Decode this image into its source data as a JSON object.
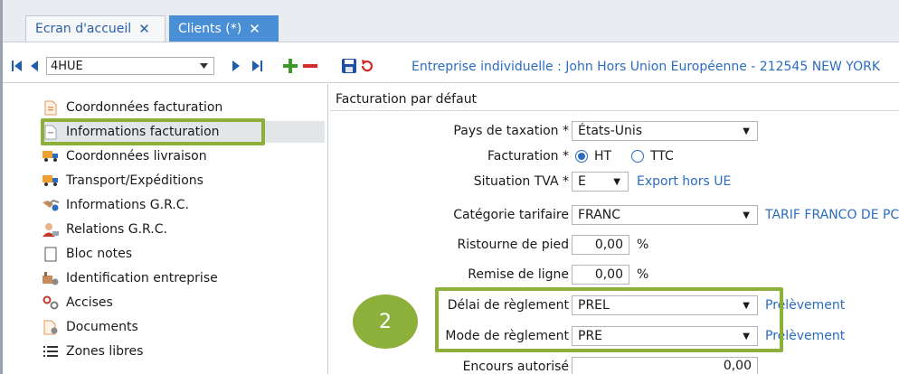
{
  "tabs": [
    {
      "label": "Ecran d'accueil",
      "close": "✕"
    },
    {
      "label": "Clients (*)",
      "close": "✕"
    }
  ],
  "toolbar": {
    "record_value": "4HUE",
    "entreprise_label": "Entreprise individuelle : John Hors Union Européenne - 212545 NEW YORK"
  },
  "sidebar": {
    "items": [
      {
        "label": "Coordonnées facturation",
        "icon": "document-icon"
      },
      {
        "label": "Informations facturation",
        "icon": "document-icon"
      },
      {
        "label": "Coordonnées livraison",
        "icon": "truck-icon"
      },
      {
        "label": "Transport/Expéditions",
        "icon": "truck-icon"
      },
      {
        "label": "Informations G.R.C.",
        "icon": "handshake-icon"
      },
      {
        "label": "Relations G.R.C.",
        "icon": "user-icon"
      },
      {
        "label": "Bloc notes",
        "icon": "note-icon"
      },
      {
        "label": "Identification entreprise",
        "icon": "factory-icon"
      },
      {
        "label": "Accises",
        "icon": "gears-icon"
      },
      {
        "label": "Documents",
        "icon": "document-icon"
      },
      {
        "label": "Zones libres",
        "icon": "list-icon"
      }
    ]
  },
  "form": {
    "section_title": "Facturation par défaut",
    "pays_label": "Pays de taxation *",
    "pays_value": "États-Unis",
    "facturation_label": "Facturation *",
    "facturation_options": [
      "HT",
      "TTC"
    ],
    "tva_label": "Situation TVA *",
    "tva_value": "E",
    "tva_link": "Export hors UE",
    "categorie_label": "Catégorie tarifaire",
    "categorie_value": "FRANC",
    "categorie_link": "TARIF FRANCO DE PC",
    "ristourne_label": "Ristourne de pied",
    "ristourne_value": "0,00",
    "remise_label": "Remise de ligne",
    "remise_value": "0,00",
    "percent": "%",
    "delai_label": "Délai de règlement",
    "delai_value": "PREL",
    "delai_link": "Prélèvement",
    "mode_label": "Mode de règlement",
    "mode_value": "PRE",
    "mode_link": "Prélèvement",
    "encours_label": "Encours autorisé",
    "encours_value": "0,00"
  },
  "annotation": {
    "badge": "2"
  },
  "colors": {
    "accent": "#4a8ed6",
    "highlight": "#8cb03a",
    "link": "#2b6cbf"
  }
}
